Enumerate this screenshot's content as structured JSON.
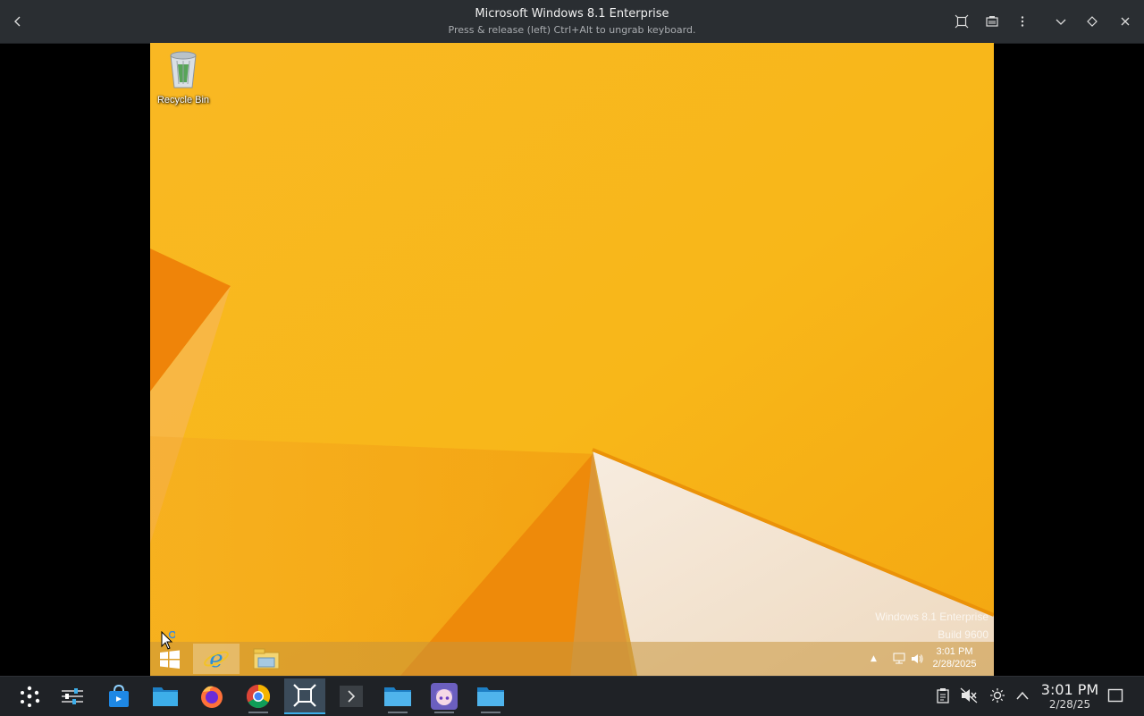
{
  "viewer": {
    "title": "Microsoft Windows 8.1 Enterprise",
    "subtitle": "Press & release (left) Ctrl+Alt to ungrab keyboard."
  },
  "desktop": {
    "recycle_bin_label": "Recycle Bin",
    "watermark_line1": "Windows 8.1 Enterprise",
    "watermark_line2": "Build 9600"
  },
  "guest_taskbar": {
    "apps": [
      "windows-start-icon",
      "internet-explorer-icon",
      "file-explorer-icon"
    ],
    "time": "3:01 PM",
    "date": "2/28/2025"
  },
  "host_taskbar": {
    "apps": [
      "application-launcher-icon",
      "settings-icon",
      "discover-store-icon",
      "file-manager-icon",
      "firefox-icon",
      "chrome-icon",
      "virt-manager-icon",
      "terminal-icon",
      "file-manager-icon",
      "anime-app-icon",
      "file-manager-icon"
    ],
    "time": "3:01 PM",
    "date": "2/28/25"
  },
  "colors": {
    "wallpaper_main": "#f7b21a",
    "wallpaper_dark": "#ef8c08",
    "accent": "#3daee9"
  }
}
